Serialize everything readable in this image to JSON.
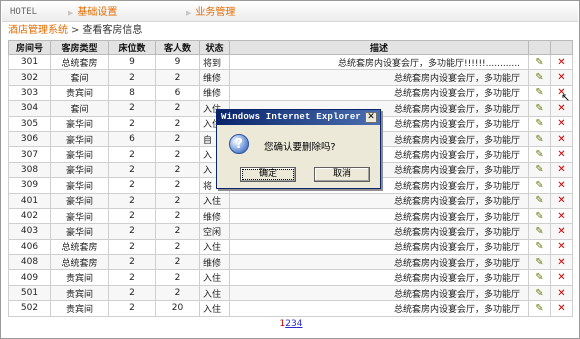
{
  "topbar": {
    "brand": "HOTEL",
    "tabs": [
      {
        "label": "基础设置"
      },
      {
        "label": "业务管理"
      }
    ]
  },
  "breadcrumb": {
    "home": "酒店管理系统",
    "separator": ">",
    "current": "查看客房信息"
  },
  "table": {
    "headers": [
      "房间号",
      "客房类型",
      "床位数",
      "客人数",
      "状态",
      "描述",
      "",
      ""
    ],
    "rows": [
      {
        "room": "301",
        "type": "总统套房",
        "beds": "9",
        "guests": "9",
        "status": "将到",
        "desc": "总统套房内设宴会厅，多功能厅!!!!!!............"
      },
      {
        "room": "302",
        "type": "套间",
        "beds": "2",
        "guests": "2",
        "status": "维修",
        "desc": "总统套房内设宴会厅，多功能厅"
      },
      {
        "room": "303",
        "type": "贵宾间",
        "beds": "8",
        "guests": "6",
        "status": "维修",
        "desc": "总统套房内设宴会厅，多功能厅"
      },
      {
        "room": "304",
        "type": "套间",
        "beds": "2",
        "guests": "2",
        "status": "入住",
        "desc": "总统套房内设宴会厅，多功能厅"
      },
      {
        "room": "305",
        "type": "豪华间",
        "beds": "2",
        "guests": "2",
        "status": "入住",
        "desc": "总统套房内设宴会厅，多功能厅"
      },
      {
        "room": "306",
        "type": "豪华间",
        "beds": "6",
        "guests": "2",
        "status": "自",
        "desc": "总统套房内设宴会厅，多功能厅"
      },
      {
        "room": "307",
        "type": "豪华间",
        "beds": "2",
        "guests": "2",
        "status": "入",
        "desc": "总统套房内设宴会厅，多功能厅"
      },
      {
        "room": "308",
        "type": "豪华间",
        "beds": "2",
        "guests": "2",
        "status": "入",
        "desc": "总统套房内设宴会厅，多功能厅"
      },
      {
        "room": "309",
        "type": "豪华间",
        "beds": "2",
        "guests": "2",
        "status": "将",
        "desc": "总统套房内设宴会厅，多功能厅"
      },
      {
        "room": "401",
        "type": "豪华间",
        "beds": "2",
        "guests": "2",
        "status": "入住",
        "desc": "总统套房内设宴会厅，多功能厅"
      },
      {
        "room": "402",
        "type": "豪华间",
        "beds": "2",
        "guests": "2",
        "status": "维修",
        "desc": "总统套房内设宴会厅，多功能厅"
      },
      {
        "room": "403",
        "type": "豪华间",
        "beds": "2",
        "guests": "2",
        "status": "空闲",
        "desc": "总统套房内设宴会厅，多功能厅"
      },
      {
        "room": "406",
        "type": "总统套房",
        "beds": "2",
        "guests": "2",
        "status": "入住",
        "desc": "总统套房内设宴会厅，多功能厅"
      },
      {
        "room": "408",
        "type": "总统套房",
        "beds": "2",
        "guests": "2",
        "status": "维修",
        "desc": "总统套房内设宴会厅，多功能厅"
      },
      {
        "room": "409",
        "type": "贵宾间",
        "beds": "2",
        "guests": "2",
        "status": "入住",
        "desc": "总统套房内设宴会厅，多功能厅"
      },
      {
        "room": "501",
        "type": "贵宾间",
        "beds": "2",
        "guests": "2",
        "status": "入住",
        "desc": "总统套房内设宴会厅，多功能厅"
      },
      {
        "room": "502",
        "type": "贵宾间",
        "beds": "2",
        "guests": "20",
        "status": "入住",
        "desc": "总统套房内设宴会厅，多功能厅"
      }
    ]
  },
  "pager": {
    "current": "1",
    "pages": [
      "2",
      "3",
      "4"
    ]
  },
  "dialog": {
    "title": "Windows Internet Explorer",
    "close_glyph": "✕",
    "icon_glyph": "?",
    "message": "您确认要删除吗?",
    "ok_label": "确定",
    "cancel_label": "取消"
  },
  "icons": {
    "edit": "edit-icon",
    "delete": "delete-icon"
  },
  "colors": {
    "accent": "#e46b00",
    "delete": "#d40000",
    "dialog_title": "#0a246a"
  }
}
